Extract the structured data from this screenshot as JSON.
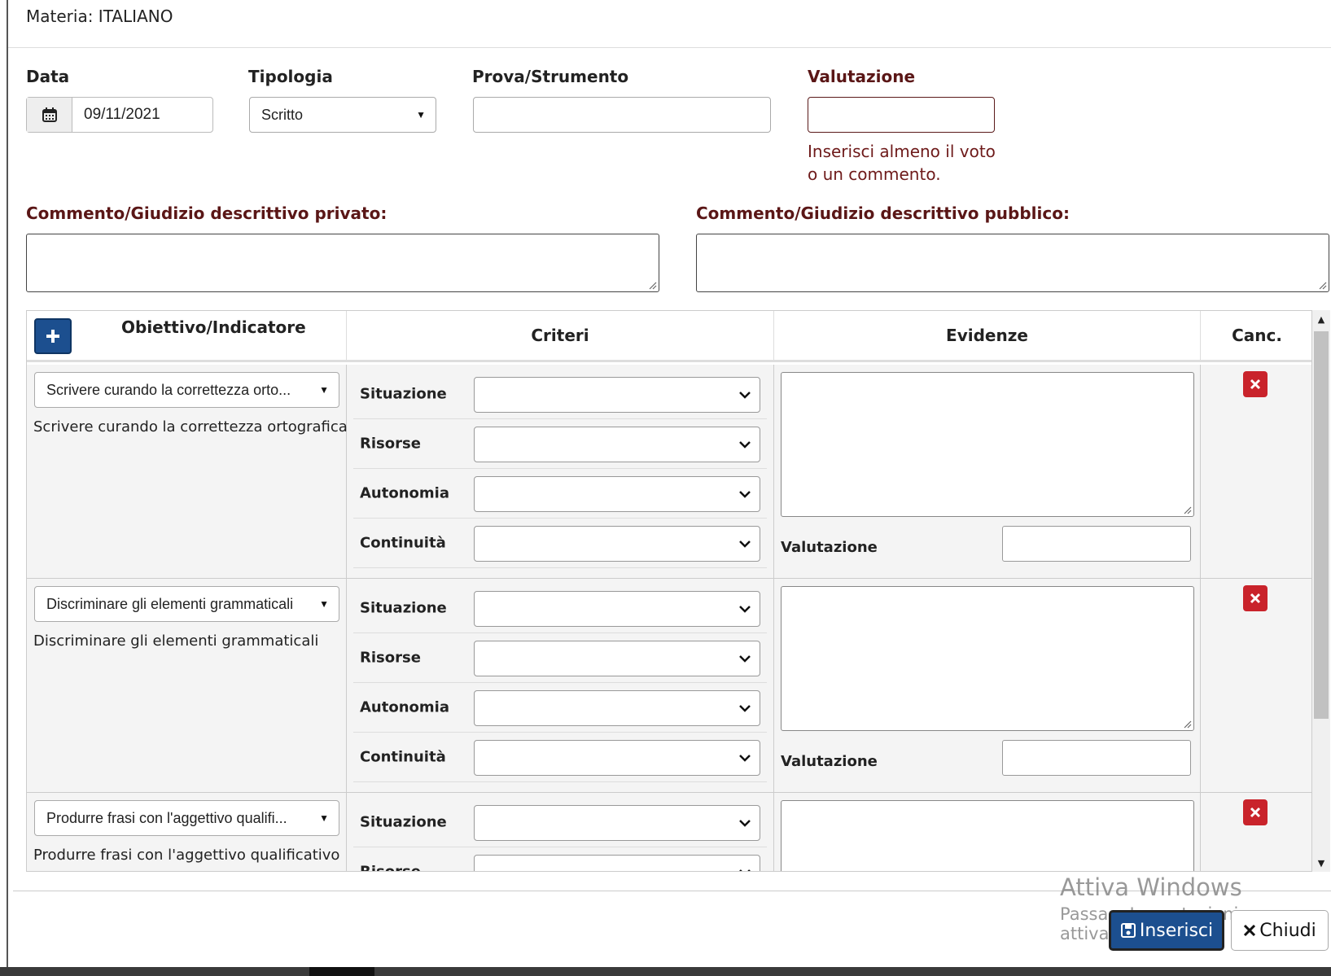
{
  "subject": "Materia: ITALIANO",
  "fields": {
    "date_label": "Data",
    "date_value": "09/11/2021",
    "type_label": "Tipologia",
    "type_value": "Scritto",
    "test_label": "Prova/Strumento",
    "test_value": "",
    "grade_label": "Valutazione",
    "grade_value": "",
    "error_line1": "Inserisci almeno il voto",
    "error_line2": "o un commento."
  },
  "comments": {
    "private_label": "Commento/Giudizio descrittivo privato:",
    "public_label": "Commento/Giudizio descrittivo pubblico:"
  },
  "table": {
    "headers": {
      "objective": "Obiettivo/Indicatore",
      "criteria": "Criteri",
      "evidence": "Evidenze",
      "delete": "Canc."
    },
    "criteria_labels": [
      "Situazione",
      "Risorse",
      "Autonomia",
      "Continuità"
    ],
    "evidence_grade_label": "Valutazione",
    "rows": [
      {
        "objective_select": "Scrivere curando la correttezza orto...",
        "objective_desc": "Scrivere curando la correttezza ortografica"
      },
      {
        "objective_select": "Discriminare gli elementi grammaticali",
        "objective_desc": "Discriminare gli elementi grammaticali"
      },
      {
        "objective_select": "Produrre frasi con l'aggettivo qualifi...",
        "objective_desc": "Produrre frasi con l'aggettivo qualificativo"
      }
    ]
  },
  "footer": {
    "insert_label": "Inserisci",
    "close_label": "Chiudi"
  },
  "watermark": {
    "line1": "Attiva Windows",
    "line2": "Passa a Impostazioni per attivare"
  },
  "icons": {
    "calendar": "calendar-icon",
    "plus": "plus-icon",
    "delete": "delete-x-icon",
    "save": "save-icon",
    "close": "close-icon",
    "chevron": "chevron-down-icon"
  },
  "colors": {
    "primary": "#1c4f8f",
    "danger": "#c9232b",
    "required_label": "#5a1616"
  }
}
